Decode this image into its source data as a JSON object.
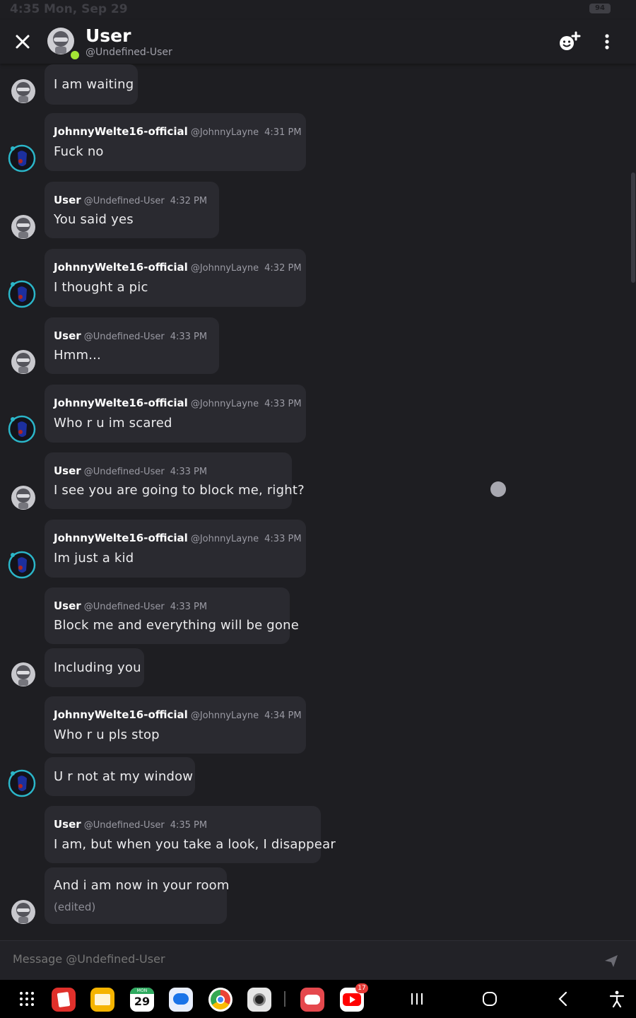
{
  "status_bar": {
    "time": "4:35",
    "date": "Mon, Sep 29",
    "battery": "94"
  },
  "header": {
    "title": "User",
    "subtitle": "@Undefined-User",
    "online_color": "#a3e635"
  },
  "messages": [
    {
      "sender": "User",
      "handle": "",
      "time": "",
      "text": "I am waiting",
      "edited": ""
    },
    {
      "sender": "JohnnyWelte16-official",
      "handle": "@JohnnyLayne",
      "time": "4:31 PM",
      "text": "Fuck no"
    },
    {
      "sender": "User",
      "handle": "@Undefined-User",
      "time": "4:32 PM",
      "text": "You said yes"
    },
    {
      "sender": "JohnnyWelte16-official",
      "handle": "@JohnnyLayne",
      "time": "4:32 PM",
      "text": "I thought a pic"
    },
    {
      "sender": "User",
      "handle": "@Undefined-User",
      "time": "4:33 PM",
      "text": "Hmm..."
    },
    {
      "sender": "JohnnyWelte16-official",
      "handle": "@JohnnyLayne",
      "time": "4:33 PM",
      "text": "Who r u im scared"
    },
    {
      "sender": "User",
      "handle": "@Undefined-User",
      "time": "4:33 PM",
      "text": "I see you are going to block me, right?"
    },
    {
      "sender": "JohnnyWelte16-official",
      "handle": "@JohnnyLayne",
      "time": "4:33 PM",
      "text": "Im just a kid"
    },
    {
      "sender": "User",
      "handle": "@Undefined-User",
      "time": "4:33 PM",
      "text": "Block me and everything will be gone"
    },
    {
      "sender": "User",
      "handle": "",
      "time": "",
      "text": "Including you"
    },
    {
      "sender": "JohnnyWelte16-official",
      "handle": "@JohnnyLayne",
      "time": "4:34 PM",
      "text": "Who r u pls stop"
    },
    {
      "sender": "JohnnyWelte16-official",
      "handle": "",
      "time": "",
      "text": "U r not at my window"
    },
    {
      "sender": "User",
      "handle": "@Undefined-User",
      "time": "4:35 PM",
      "text": "I am, but when you take a look, I disappear"
    },
    {
      "sender": "User",
      "handle": "",
      "time": "",
      "text": "And i am now in your room",
      "edited": "(edited)"
    }
  ],
  "composer": {
    "placeholder": "Message @Undefined-User"
  },
  "navbar": {
    "calendar_day": "29",
    "calendar_month": "MON",
    "youtube_badge": "17"
  },
  "colors": {
    "background": "#1e1e22",
    "bubble": "#2a2a30",
    "accent_online": "#a3e635"
  },
  "icons": [
    "close-icon",
    "add-friend-icon",
    "more-vertical-icon",
    "send-icon",
    "apps-grid-icon",
    "recents-icon",
    "home-icon",
    "back-icon",
    "accessibility-icon"
  ]
}
